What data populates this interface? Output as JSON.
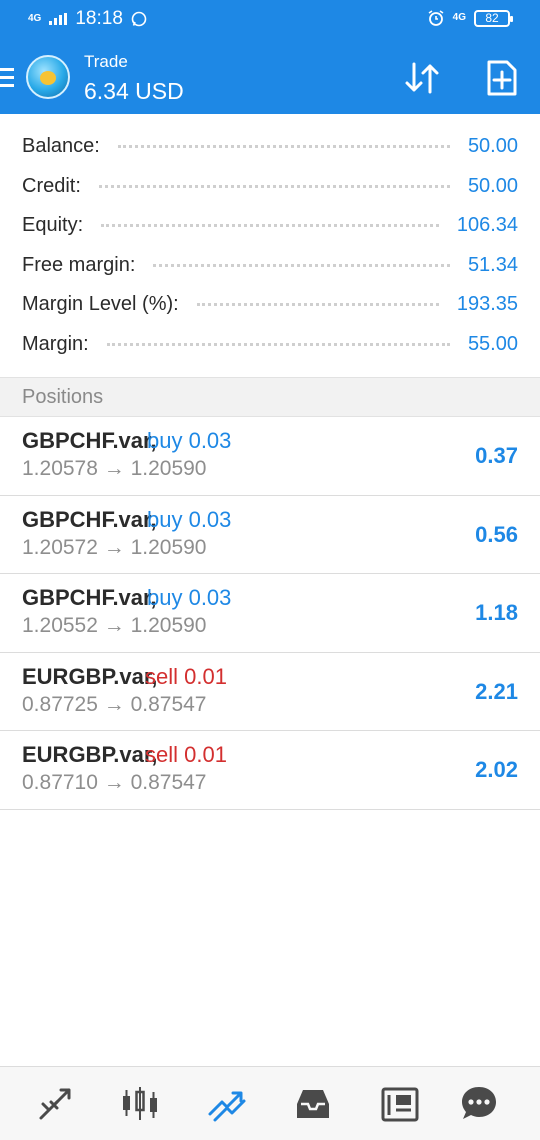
{
  "status_bar": {
    "network": "4G",
    "time": "18:18",
    "battery": "82"
  },
  "header": {
    "title": "Trade",
    "profit": "6.34 USD"
  },
  "account": [
    {
      "label": "Balance:",
      "value": "50.00"
    },
    {
      "label": "Credit:",
      "value": "50.00"
    },
    {
      "label": "Equity:",
      "value": "106.34"
    },
    {
      "label": "Free margin:",
      "value": "51.34"
    },
    {
      "label": "Margin Level (%):",
      "value": "193.35"
    },
    {
      "label": "Margin:",
      "value": "55.00"
    }
  ],
  "positions_header": "Positions",
  "positions": [
    {
      "symbol": "GBPCHF.var,",
      "side": "buy 0.03",
      "prices": "1.20578 → 1.20590",
      "profit": "0.37"
    },
    {
      "symbol": "GBPCHF.var,",
      "side": "buy 0.03",
      "prices": "1.20572 → 1.20590",
      "profit": "0.56"
    },
    {
      "symbol": "GBPCHF.var,",
      "side": "buy 0.03",
      "prices": "1.20552 → 1.20590",
      "profit": "1.18"
    },
    {
      "symbol": "EURGBP.var,",
      "side": "sell 0.01",
      "prices": "0.87725 → 0.87547",
      "profit": "2.21"
    },
    {
      "symbol": "EURGBP.var,",
      "side": "sell 0.01",
      "prices": "0.87710 → 0.87547",
      "profit": "2.02"
    }
  ],
  "bottom_nav": [
    {
      "icon": "quotes-icon"
    },
    {
      "icon": "chart-icon"
    },
    {
      "icon": "trade-icon",
      "active": true
    },
    {
      "icon": "history-icon"
    },
    {
      "icon": "news-icon"
    },
    {
      "icon": "chat-icon"
    }
  ],
  "colors": {
    "accent": "#1e88e5",
    "sell": "#d32f2f",
    "muted": "#8e8e8e"
  }
}
